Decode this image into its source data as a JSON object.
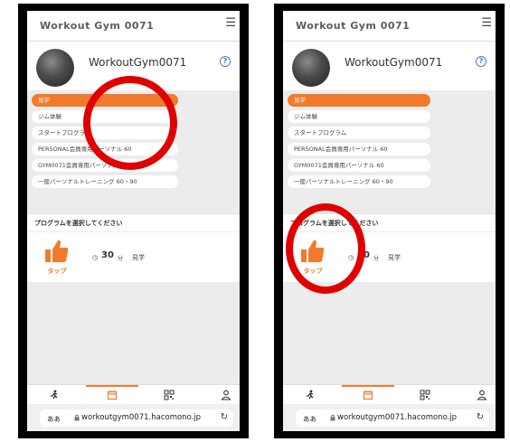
{
  "app": {
    "logo_text": "Workout Gym 0071",
    "gym_name": "WorkoutGym0071",
    "help_label": "?",
    "menu_icon": "hamburger-icon"
  },
  "categories": [
    {
      "label": "見学",
      "active": true
    },
    {
      "label": "ジム体験",
      "active": false
    },
    {
      "label": "スタートプログラム",
      "active": false
    },
    {
      "label": "PERSONAL会員専用パーソナル 60",
      "active": false
    },
    {
      "label": "GYM0071会員専用パーソナル 60",
      "active": false
    },
    {
      "label": "一般パーソナルトレーニング 60・90",
      "active": false
    }
  ],
  "prompt": "プログラムを選択してください",
  "program": {
    "tap_label": "タップ",
    "duration": "30",
    "unit": "分",
    "name": "見学"
  },
  "tabs": [
    "runner-icon",
    "calendar-icon",
    "qr-icon",
    "person-icon"
  ],
  "browser": {
    "aa_label": "ああ",
    "url": "workoutgym0071.hacomono.jp",
    "reload_icon": "reload-icon"
  },
  "colors": {
    "accent": "#f27a2c",
    "annotation": "#e00000"
  }
}
